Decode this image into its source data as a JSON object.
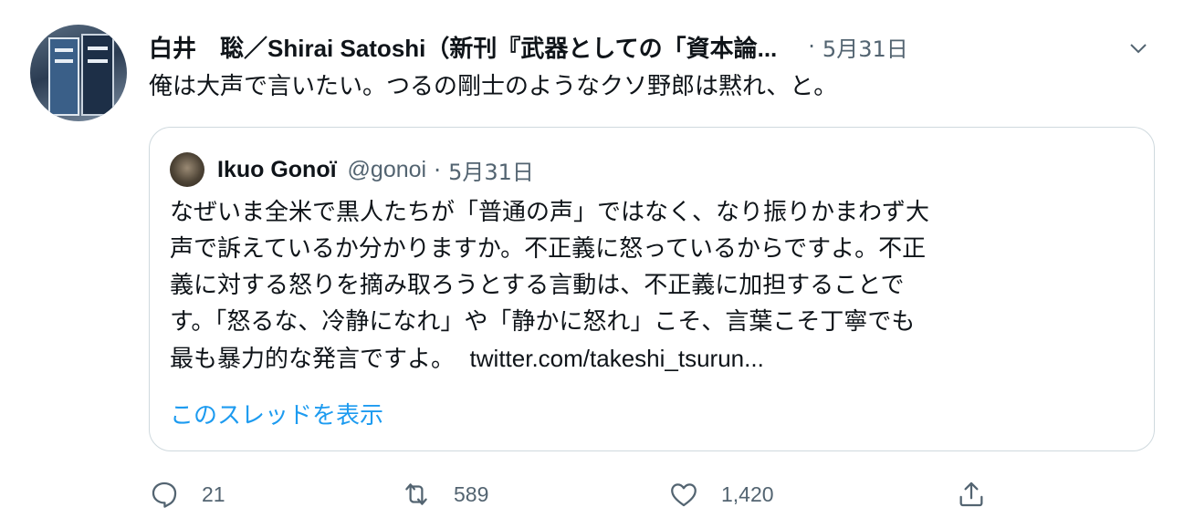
{
  "author": {
    "display_name": "白井　聡／Shirai Satoshi（新刊『武器としての「資本論...",
    "date": "5月31日",
    "separator": "·",
    "menu_icon": "chevron-down-icon"
  },
  "tweet": {
    "text": "俺は大声で言いたい。つるの剛士のようなクソ野郎は黙れ、と。"
  },
  "quoted": {
    "name": "Ikuo Gonoï",
    "handle": "@gonoi",
    "separator": "·",
    "date": "5月31日",
    "lines": [
      "なぜいま全米で黒人たちが「普通の声」ではなく、なり振りかまわず大",
      "声で訴えているか分かりますか。不正義に怒っているからですよ。不正",
      "義に対する怒りを摘み取ろうとする言動は、不正義に加担することで",
      "す。「怒るな、冷静になれ」や「静かに怒れ」こそ、言葉こそ丁寧でも"
    ],
    "last_line_text": "最も暴力的な発言ですよ。",
    "link": "twitter.com/takeshi_tsurun...",
    "show_thread": "このスレッドを表示"
  },
  "actions": {
    "reply": {
      "icon": "reply-icon",
      "count": "21"
    },
    "retweet": {
      "icon": "retweet-icon",
      "count": "589"
    },
    "like": {
      "icon": "heart-icon",
      "count": "1,420"
    },
    "share": {
      "icon": "share-icon"
    }
  },
  "colors": {
    "text": "#0f1419",
    "secondary": "#536471",
    "link": "#1d9bf0",
    "border": "#cfd9de"
  }
}
